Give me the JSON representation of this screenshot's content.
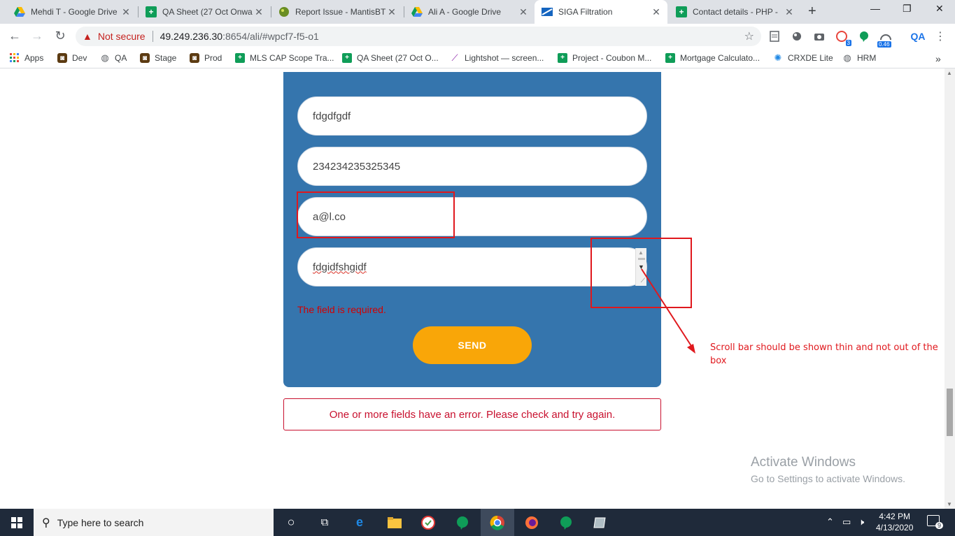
{
  "tabs": [
    {
      "title": "Mehdi T - Google Drive",
      "icon": "google-drive-icon"
    },
    {
      "title": "QA Sheet (27 Oct Onwa",
      "icon": "google-sheets-icon"
    },
    {
      "title": "Report Issue - MantisBT",
      "icon": "mantisbt-icon"
    },
    {
      "title": "Ali A - Google Drive",
      "icon": "google-drive-icon"
    },
    {
      "title": "SIGA Filtration",
      "icon": "siga-icon"
    },
    {
      "title": "Contact details - PHP -",
      "icon": "google-sheets-icon"
    }
  ],
  "toolbar": {
    "not_secure": "Not secure",
    "url_host": "49.249.236.30",
    "url_rest": ":8654/ali/#wpcf7-f5-o1",
    "ext_badge_1": "3",
    "ext_badge_2": "0.46",
    "ext_qa": "QA"
  },
  "bookmarks": [
    {
      "label": "Apps",
      "icon": "apps-grid-icon"
    },
    {
      "label": "Dev",
      "icon": "dev-icon"
    },
    {
      "label": "QA",
      "icon": "globe-icon"
    },
    {
      "label": "Stage",
      "icon": "stage-icon"
    },
    {
      "label": "Prod",
      "icon": "prod-icon"
    },
    {
      "label": "MLS CAP Scope Tra...",
      "icon": "google-sheets-icon"
    },
    {
      "label": "QA Sheet (27 Oct O...",
      "icon": "google-sheets-icon"
    },
    {
      "label": "Lightshot — screen...",
      "icon": "lightshot-feather-icon"
    },
    {
      "label": "Project - Coubon M...",
      "icon": "google-sheets-icon"
    },
    {
      "label": "Mortgage Calculato...",
      "icon": "google-sheets-icon"
    },
    {
      "label": "CRXDE Lite",
      "icon": "crxde-icon"
    },
    {
      "label": "HRM",
      "icon": "globe-icon"
    }
  ],
  "form": {
    "name_value": "fdgdfgdf",
    "phone_value": "234234235325345",
    "email_value": "a@l.co",
    "message_value": "fdgidfshgidf",
    "required_error": "The field is required.",
    "send_label": "SEND",
    "validation_error": "One or more fields have an error. Please check and try again."
  },
  "annotation": {
    "note": "Scroll bar should be shown thin and not out of the box",
    "color": "#e0181d"
  },
  "watermark": {
    "line1": "Activate Windows",
    "line2": "Go to Settings to activate Windows."
  },
  "taskbar": {
    "search_placeholder": "Type here to search",
    "time": "4:42 PM",
    "date": "4/13/2020",
    "notification_count": "9"
  },
  "colors": {
    "form_panel": "#3575ad",
    "send_button": "#f9a608",
    "error_red": "#c8102e"
  }
}
